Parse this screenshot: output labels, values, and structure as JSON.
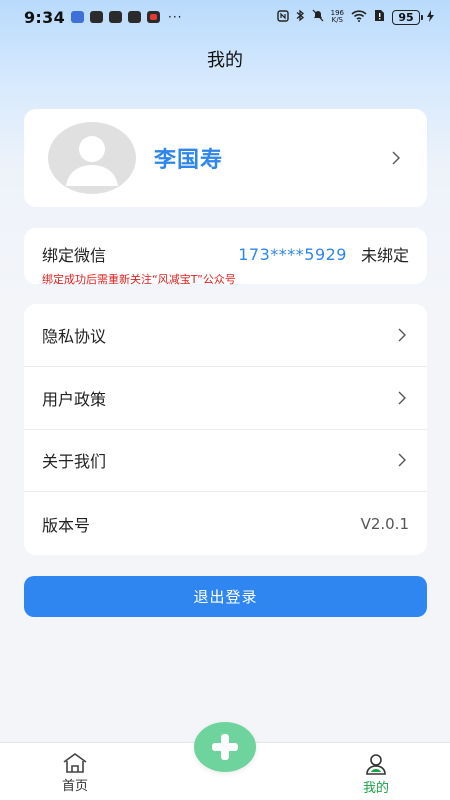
{
  "status_bar": {
    "time": "9:34",
    "dots": "···",
    "netspeed_top": "196",
    "netspeed_bottom": "K/S",
    "battery": "95"
  },
  "header": {
    "title": "我的"
  },
  "profile": {
    "name": "李国寿"
  },
  "bind": {
    "label": "绑定微信",
    "phone": "173****5929",
    "status": "未绑定",
    "note": "绑定成功后需重新关注“风减宝T”公众号"
  },
  "menu": {
    "items": [
      {
        "label": "隐私协议"
      },
      {
        "label": "用户政策"
      },
      {
        "label": "关于我们"
      },
      {
        "label": "版本号",
        "value": "V2.0.1"
      }
    ]
  },
  "logout": {
    "label": "退出登录"
  },
  "bottom_nav": {
    "home_label": "首页",
    "mine_label": "我的",
    "active_color": "#1aa34a"
  },
  "colors": {
    "accent": "#2f86ea",
    "button": "#2f86f0",
    "warning": "#e02020",
    "fab": "#6fd39e"
  }
}
